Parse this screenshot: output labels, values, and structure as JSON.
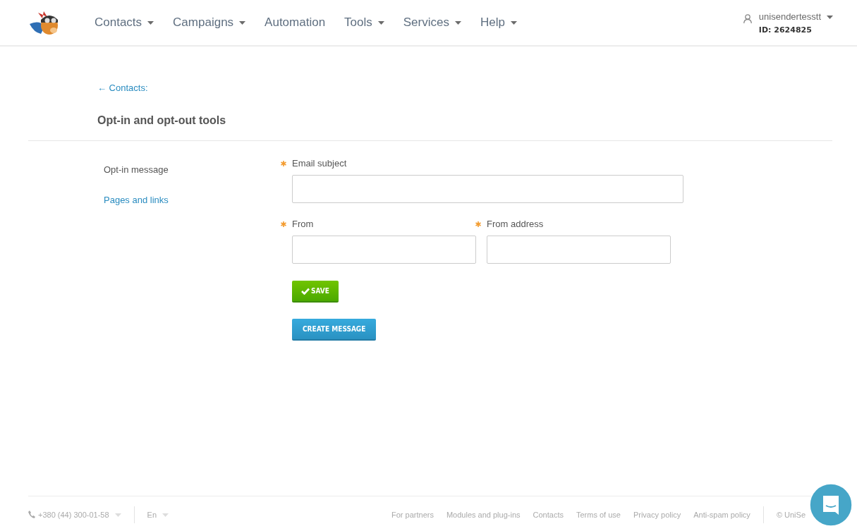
{
  "header": {
    "nav": [
      {
        "label": "Contacts",
        "dropdown": true
      },
      {
        "label": "Campaigns",
        "dropdown": true
      },
      {
        "label": "Automation",
        "dropdown": false
      },
      {
        "label": "Tools",
        "dropdown": true
      },
      {
        "label": "Services",
        "dropdown": true
      },
      {
        "label": "Help",
        "dropdown": true
      }
    ],
    "user": {
      "name": "unisendertesstt",
      "id": "ID: 2624825"
    }
  },
  "breadcrumb": "← Contacts:",
  "title": "Opt-in and opt-out tools",
  "sidebar": {
    "items": [
      {
        "label": "Opt-in message",
        "selected": true
      },
      {
        "label": "Pages and links",
        "selected": false
      }
    ]
  },
  "form": {
    "rows": [
      [
        {
          "label": "Email subject",
          "required": true
        }
      ],
      [
        {
          "label": "From",
          "required": true
        },
        {
          "label": "From address",
          "required": true
        }
      ]
    ],
    "buttons": [
      {
        "label": "SAVE",
        "kind": "save"
      },
      {
        "label": "CREATE MESSAGE",
        "kind": "create"
      }
    ]
  },
  "footer": {
    "phone": "+380 (44) 300-01-58",
    "language": "En",
    "links": [
      "For partners",
      "Modules and plug-ins",
      "Contacts",
      "Terms of use",
      "Privacy policy",
      "Anti-spam policy"
    ],
    "copyright": "© UniSe"
  }
}
